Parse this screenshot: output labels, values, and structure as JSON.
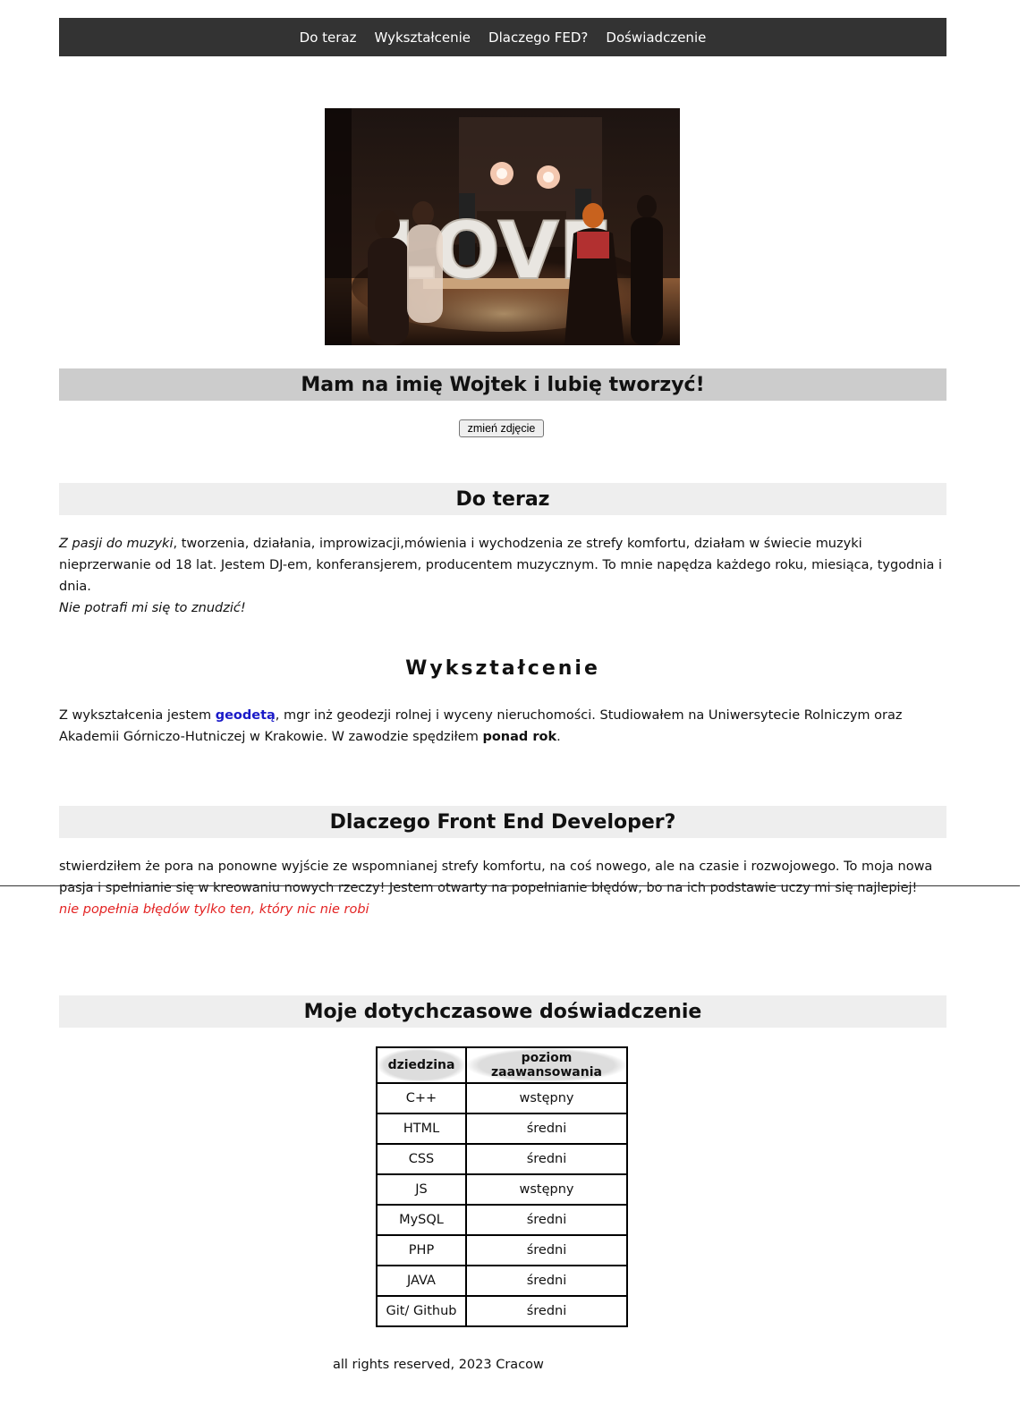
{
  "nav": {
    "items": [
      {
        "label": "Do teraz"
      },
      {
        "label": "Wykształcenie"
      },
      {
        "label": "Dlaczego FED?"
      },
      {
        "label": "Doświadczenie"
      }
    ]
  },
  "hero": {
    "title": "Mam na imię Wojtek i lubię tworzyć!",
    "change_photo_label": "zmień zdjęcie",
    "image_letters": "LOVE"
  },
  "section_do_teraz": {
    "heading": "Do teraz",
    "lead_italic": "Z pasji do muzyki",
    "text": ", tworzenia, działania, improwizacji,mówienia i wychodzenia ze strefy komfortu, działam w świecie muzyki nieprzerwanie od 18 lat. Jestem DJ-em, konferansjerem, producentem muzycznym. To mnie napędza każdego roku, miesiąca, tygodnia i dnia.",
    "closing_italic": "Nie potrafi mi się to znudzić!"
  },
  "section_edu": {
    "heading": "Wykształcenie",
    "text_before": "Z wykształcenia jestem ",
    "link": "geodetą",
    "text_after": ", mgr inż geodezji rolnej i wyceny nieruchomości. Studiowałem na Uniwersytecie Rolniczym oraz Akademii Górniczo-Hutniczej w Krakowie. W zawodzie spędziłem ",
    "bold": "ponad rok",
    "end": "."
  },
  "section_fed": {
    "heading": "Dlaczego Front End Developer?",
    "text": "stwierdziłem że pora na ponowne wyjście ze wspomnianej strefy komfortu, na coś nowego, ale na czasie i rozwojowego. To moja nowa pasja i spełnianie się w kreowaniu nowych rzeczy! Jestem otwarty na popełnianie błędów, bo na ich podstawie uczy mi się najlepiej!",
    "quote": "nie popełnia błędów tylko ten, który nic nie robi",
    "quote_color": "#e32424"
  },
  "section_exp": {
    "heading": "Moje dotychczasowe doświadczenie",
    "table": {
      "headers": [
        "dziedzina",
        "poziom zaawansowania"
      ],
      "rows": [
        [
          "C++",
          "wstępny"
        ],
        [
          "HTML",
          "średni"
        ],
        [
          "CSS",
          "średni"
        ],
        [
          "JS",
          "wstępny"
        ],
        [
          "MySQL",
          "średni"
        ],
        [
          "PHP",
          "średni"
        ],
        [
          "JAVA",
          "średni"
        ],
        [
          "Git/ Github",
          "średni"
        ]
      ]
    }
  },
  "footer": {
    "text": "all rights reserved, 2023 Cracow"
  },
  "colors": {
    "nav_bg": "#333333",
    "heading_bar_dark": "#cccccc",
    "heading_bar_light": "#eeeeee",
    "link": "#1a1ac8"
  }
}
